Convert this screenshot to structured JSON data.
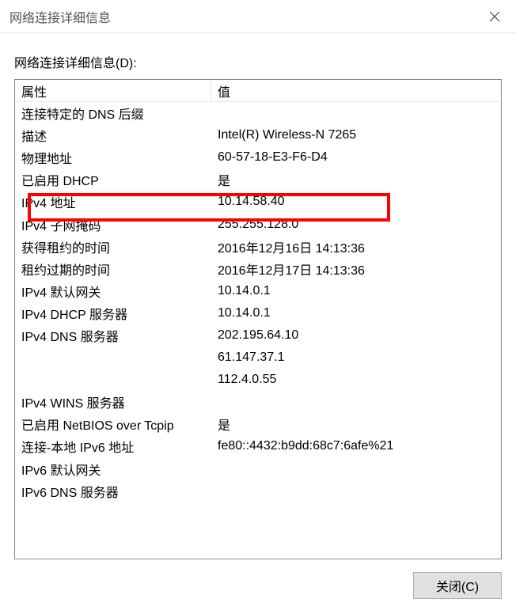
{
  "titlebar": {
    "title": "网络连接详细信息"
  },
  "section_label": "网络连接详细信息(D):",
  "headers": {
    "property": "属性",
    "value": "值"
  },
  "rows": [
    {
      "p": "连接特定的 DNS 后缀",
      "v": ""
    },
    {
      "p": "描述",
      "v": "Intel(R) Wireless-N 7265"
    },
    {
      "p": "物理地址",
      "v": "60-57-18-E3-F6-D4"
    },
    {
      "p": "已启用 DHCP",
      "v": "是"
    },
    {
      "p": "IPv4 地址",
      "v": "10.14.58.40"
    },
    {
      "p": "IPv4 子网掩码",
      "v": "255.255.128.0"
    },
    {
      "p": "获得租约的时间",
      "v": "2016年12月16日 14:13:36"
    },
    {
      "p": "租约过期的时间",
      "v": "2016年12月17日 14:13:36"
    },
    {
      "p": "IPv4 默认网关",
      "v": "10.14.0.1"
    },
    {
      "p": "IPv4 DHCP 服务器",
      "v": "10.14.0.1"
    },
    {
      "p": "IPv4 DNS 服务器",
      "v": "202.195.64.10"
    },
    {
      "p": "",
      "v": "61.147.37.1"
    },
    {
      "p": "",
      "v": "112.4.0.55"
    },
    {
      "p": "IPv4 WINS 服务器",
      "v": ""
    },
    {
      "p": "已启用 NetBIOS over Tcpip",
      "v": "是"
    },
    {
      "p": "连接-本地 IPv6 地址",
      "v": "fe80::4432:b9dd:68c7:6afe%21"
    },
    {
      "p": "IPv6 默认网关",
      "v": ""
    },
    {
      "p": "IPv6 DNS 服务器",
      "v": ""
    }
  ],
  "buttons": {
    "close": "关闭(C)"
  }
}
